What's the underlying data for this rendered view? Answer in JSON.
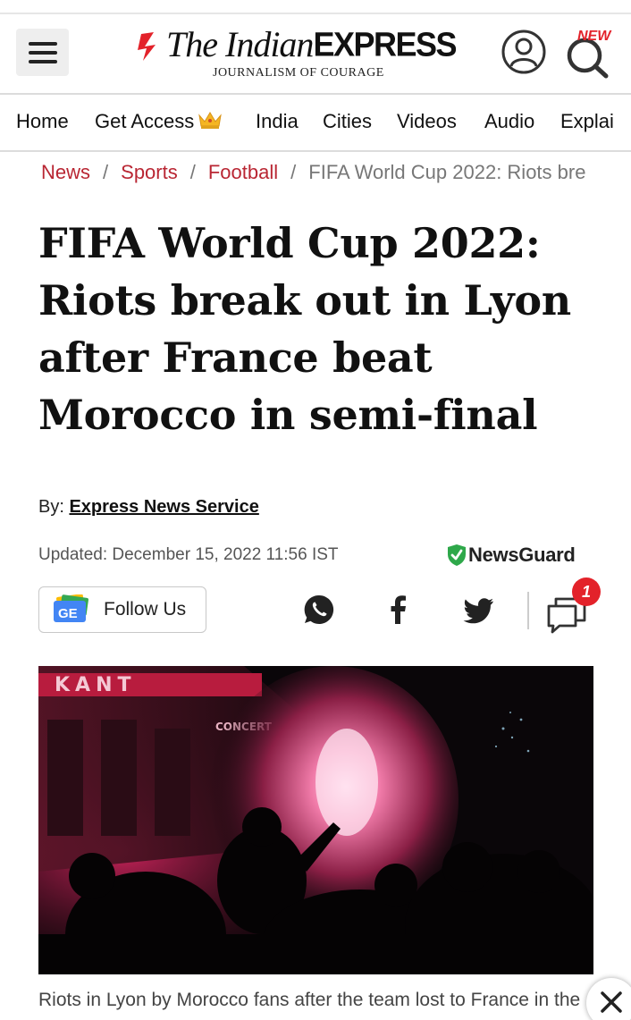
{
  "header": {
    "logo_title": "The Indian",
    "logo_express": "EXPRESS",
    "logo_tagline": "JOURNALISM OF COURAGE",
    "search_badge": "NEW",
    "brand_color": "#e3222a"
  },
  "nav": {
    "items": [
      {
        "label": "Home"
      },
      {
        "label": "Get Access"
      },
      {
        "label": "India"
      },
      {
        "label": "Cities"
      },
      {
        "label": "Videos"
      },
      {
        "label": "Audio"
      },
      {
        "label": "Explai"
      }
    ]
  },
  "breadcrumb": {
    "items": [
      "News",
      "Sports",
      "Football"
    ],
    "current": "FIFA World Cup 2022: Riots bre",
    "separator": "/",
    "link_color": "#b92633"
  },
  "article": {
    "headline": "FIFA World Cup 2022: Riots break out in Lyon after France beat Morocco in semi-final",
    "byline_prefix": "By:",
    "author": "Express News Service",
    "updated": "Updated: December 15, 2022 11:56 IST",
    "newsguard_label": "NewsGuard",
    "caption": "Riots in Lyon by Morocco fans after the team lost to France in the"
  },
  "share": {
    "follow_label": "Follow Us",
    "follow_icon_text": "GE",
    "comment_count": "1",
    "icons": [
      "whatsapp-icon",
      "facebook-icon",
      "twitter-icon",
      "comment-icon"
    ]
  },
  "image": {
    "sign_text": "KANT",
    "sign_sub": "CONCERT"
  }
}
